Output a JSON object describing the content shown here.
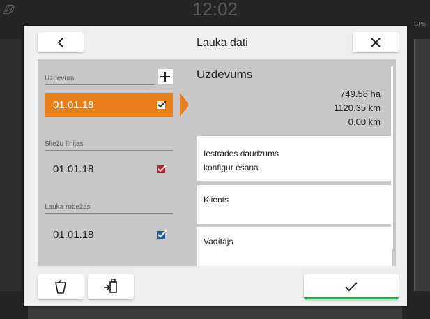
{
  "background": {
    "clock": "12:02",
    "gps_label": "GPS"
  },
  "dialog": {
    "title": "Lauka dati",
    "back_icon": "chevron-left-icon",
    "close_icon": "close-icon"
  },
  "left": {
    "tasks_label": "Uzdevumi",
    "add_icon": "plus-icon",
    "tasks": [
      {
        "label": "01.01.18",
        "selected": true
      }
    ],
    "tracks_label": "Sliežu līnijas",
    "tracks": [
      {
        "label": "01.01.18"
      }
    ],
    "boundaries_label": "Lauka robežas",
    "boundaries": [
      {
        "label": "01.01.18"
      }
    ]
  },
  "right": {
    "title": "Uzdevums",
    "area": "749.58 ha",
    "distance": "1120.35 km",
    "distance2": "0.00 km",
    "cards": [
      {
        "line1": "Iestrādes daudzums",
        "line2": "konfigur ēšana"
      },
      {
        "line1": "Klients"
      },
      {
        "line1": "Vadītājs"
      }
    ]
  },
  "footer": {
    "delete_icon": "trash-icon",
    "export_icon": "export-usb-icon",
    "confirm_icon": "checkmark-icon"
  },
  "colors": {
    "accent": "#e97f1a",
    "confirm": "#2fa84f"
  }
}
